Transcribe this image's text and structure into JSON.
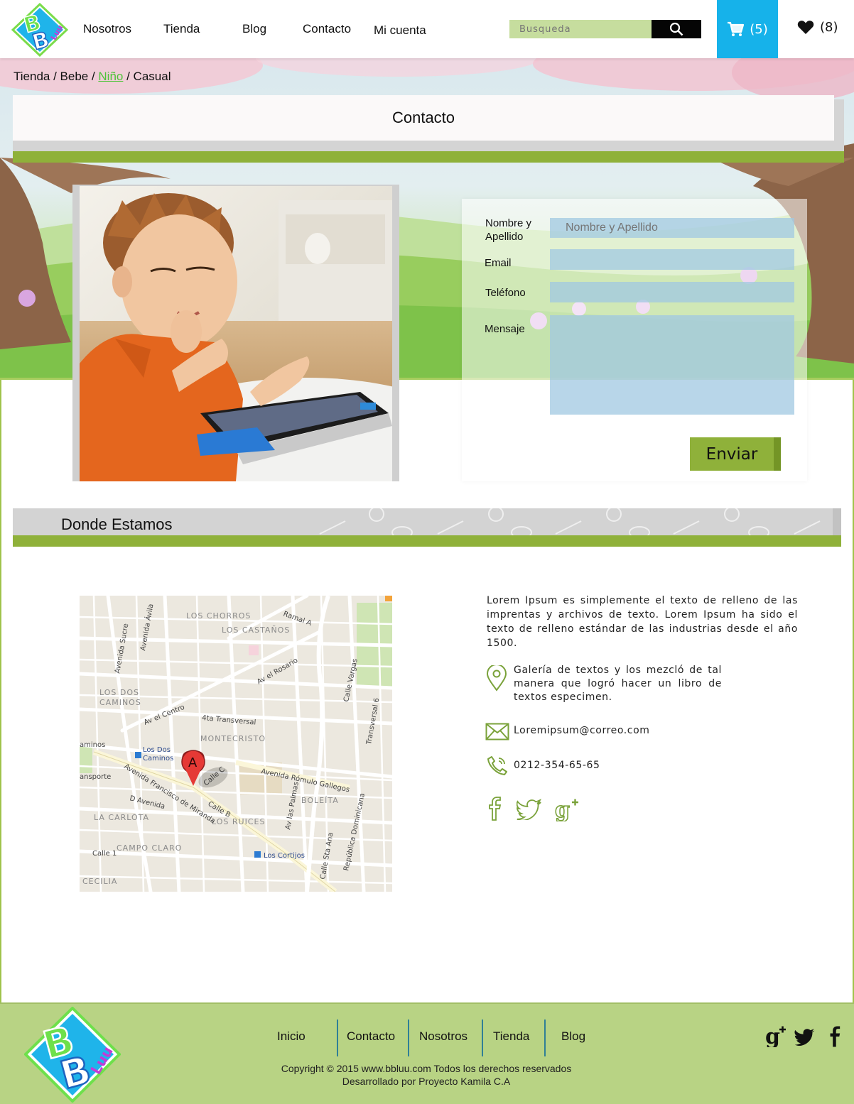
{
  "brand": {
    "logo_text_top": "B",
    "logo_text_bottom": "B",
    "logo_text_side": "Luu"
  },
  "nav": {
    "items": [
      {
        "label": "Nosotros"
      },
      {
        "label": "Tienda"
      },
      {
        "label": "Blog"
      },
      {
        "label": "Contacto"
      },
      {
        "label": "Mi cuenta"
      }
    ]
  },
  "search": {
    "placeholder": "Busqueda"
  },
  "cart": {
    "count": "(5)"
  },
  "favorites": {
    "count": "(8)"
  },
  "breadcrumb": {
    "items": [
      "Tienda",
      "Bebe",
      "Niño",
      "Casual"
    ],
    "separator": " / "
  },
  "page_title": "Contacto",
  "form": {
    "name_label": "Nombre y Apellido",
    "name_placeholder": "Nombre y Apellido",
    "email_label": "Email",
    "phone_label": "Teléfono",
    "message_label": "Mensaje",
    "submit_label": "Enviar"
  },
  "location": {
    "title": "Donde Estamos",
    "description": "Lorem Ipsum es simplemente el texto de relleno de las imprentas y archivos de texto. Lorem Ipsum ha sido el texto de relleno estándar de las industrias desde el año 1500.",
    "address": "Galería de textos y los mezcló de tal manera que logró hacer un libro de textos especimen.",
    "email": "Loremipsum@correo.com",
    "phone": "0212-354-65-65"
  },
  "map": {
    "labels": {
      "los_chorros": "LOS CHORROS",
      "los_castanos": "LOS CASTAÑOS",
      "los_dos_caminos_1": "LOS DOS",
      "los_dos_caminos_2": "CAMINOS",
      "av_el_centro": "Av el Centro",
      "transversal_4": "4ta Transversal",
      "montecristo": "MONTECRISTO",
      "los_dos_caminos_metro_1": "Los Dos",
      "los_dos_caminos_metro_2": "Caminos",
      "avenida_romulo": "Avenida Rómulo Gallegos",
      "boleita": "BOLEÍTA",
      "la_carlota": "LA CARLOTA",
      "los_ruices": "LOS RUICES",
      "campo_claro": "CAMPO CLARO",
      "los_cortijos": "Los Cortijos",
      "cecilia": "CECILIA",
      "av_rosarios": "Av el Rosario",
      "calle_vargas": "Calle Vargas",
      "avenida_sucre": "Avenida Sucre",
      "avenida_avila": "Avenida Ávila",
      "francisco_miranda": "Avenida Francisco de Miranda",
      "av_las_palmas": "Av las Palmas",
      "republica_dominicana": "República Dominicana",
      "ramal": "Ramal A",
      "calle_c": "Calle C",
      "calle_b": "Calle B",
      "calle_1": "Calle 1",
      "d_avenida": "D Avenida",
      "caminos_metro": "aminos",
      "transporte": "ansporte",
      "calle_sta_ana": "Calle Sta Ana",
      "transversal_6": "Transversal 6",
      "marker": "A"
    }
  },
  "footer": {
    "links": [
      {
        "label": "Inicio"
      },
      {
        "label": "Contacto"
      },
      {
        "label": "Nosotros"
      },
      {
        "label": "Tienda"
      },
      {
        "label": "Blog"
      }
    ],
    "copyright": "Copyright © 2015 www.bbluu.com Todos los derechos reservados",
    "developer": "Desarrollado por Proyecto Kamila C.A"
  },
  "colors": {
    "accent_blue": "#16b2ea",
    "accent_green": "#8fb13a",
    "footer_green": "#b8d384",
    "search_green": "#c6dd9e"
  },
  "icons": {
    "search": "search-icon",
    "cart": "cart-icon",
    "heart": "heart-icon",
    "location": "location-pin-icon",
    "mail": "mail-icon",
    "phone": "phone-icon",
    "facebook": "facebook-icon",
    "twitter": "twitter-icon",
    "google_plus": "google-plus-icon"
  }
}
